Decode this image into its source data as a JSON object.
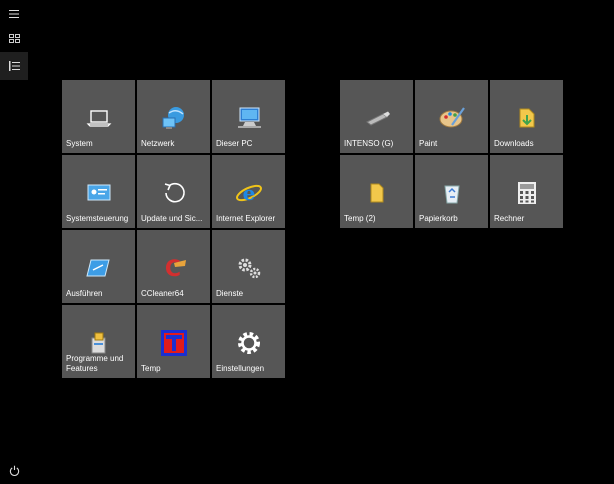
{
  "left_group": [
    {
      "name": "tile-system",
      "label": "System",
      "icon": "laptop-icon"
    },
    {
      "name": "tile-netzwerk",
      "label": "Netzwerk",
      "icon": "network-icon"
    },
    {
      "name": "tile-dieser-pc",
      "label": "Dieser PC",
      "icon": "computer-icon"
    },
    {
      "name": "tile-systemsteuerung",
      "label": "Systemsteuerung",
      "icon": "control-panel-icon"
    },
    {
      "name": "tile-update",
      "label": "Update und Sic...",
      "icon": "update-icon"
    },
    {
      "name": "tile-internet-explorer",
      "label": "Internet Explorer",
      "icon": "internet-explorer-icon"
    },
    {
      "name": "tile-ausfuehren",
      "label": "Ausführen",
      "icon": "run-icon"
    },
    {
      "name": "tile-ccleaner",
      "label": "CCleaner64",
      "icon": "ccleaner-icon"
    },
    {
      "name": "tile-dienste",
      "label": "Dienste",
      "icon": "services-gears-icon"
    },
    {
      "name": "tile-programme",
      "label": "Programme und Features",
      "icon": "programs-icon"
    },
    {
      "name": "tile-temp",
      "label": "Temp",
      "icon": "temp-t-icon"
    },
    {
      "name": "tile-einstellungen",
      "label": "Einstellungen",
      "icon": "settings-gear-icon"
    }
  ],
  "right_group": [
    {
      "name": "tile-intenso",
      "label": "INTENSO (G)",
      "icon": "usb-drive-icon"
    },
    {
      "name": "tile-paint",
      "label": "Paint",
      "icon": "paint-palette-icon"
    },
    {
      "name": "tile-downloads",
      "label": "Downloads",
      "icon": "downloads-folder-icon"
    },
    {
      "name": "tile-temp2",
      "label": "Temp (2)",
      "icon": "folder-icon"
    },
    {
      "name": "tile-papierkorb",
      "label": "Papierkorb",
      "icon": "recycle-bin-icon"
    },
    {
      "name": "tile-rechner",
      "label": "Rechner",
      "icon": "calculator-icon"
    }
  ],
  "colors": {
    "tile": "#565656",
    "background": "#000000",
    "accent": "#2d7fd3"
  }
}
